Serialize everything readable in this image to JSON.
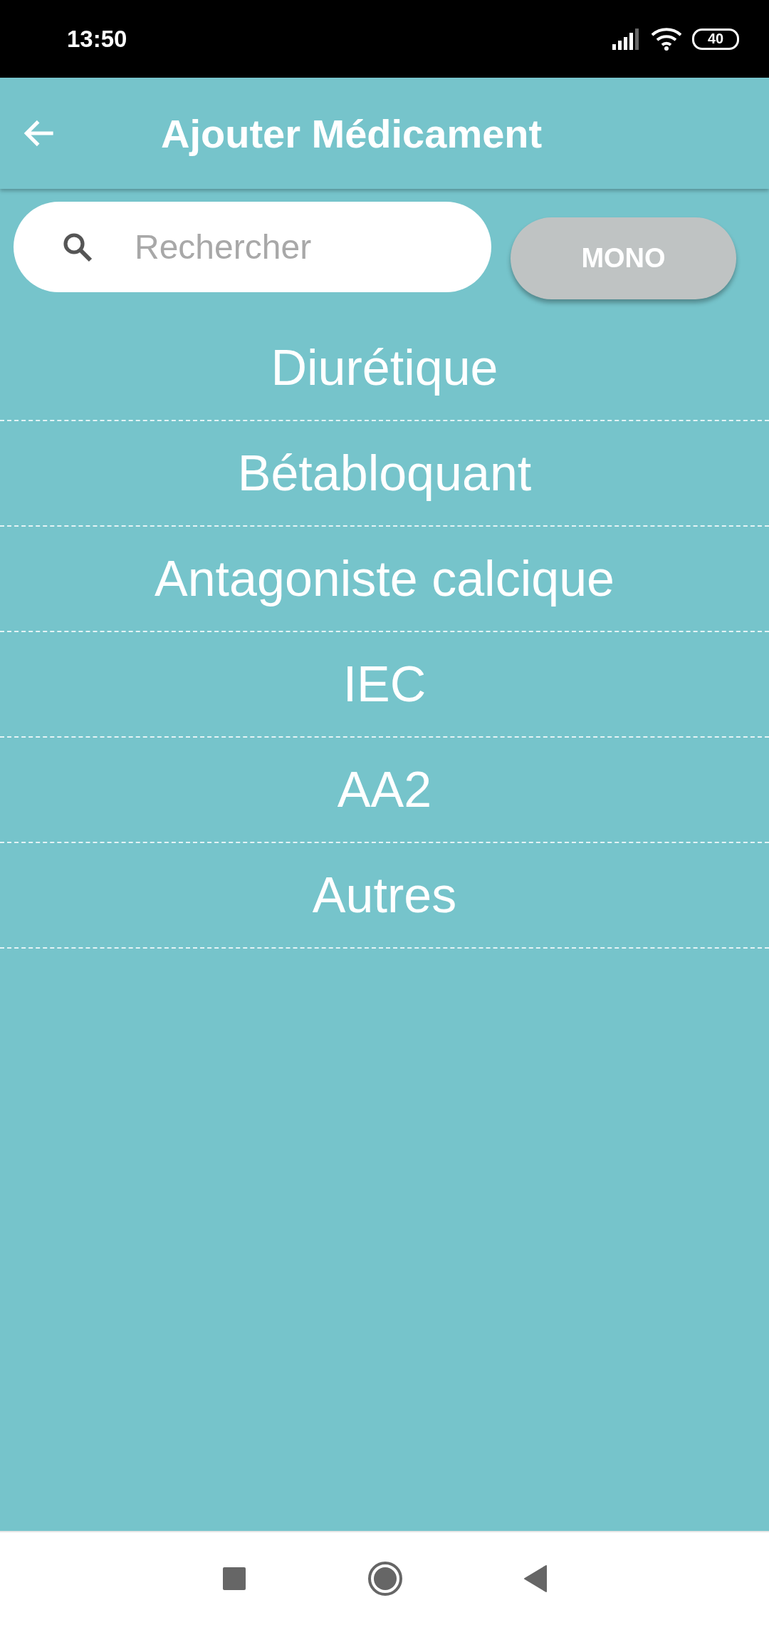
{
  "status_bar": {
    "time": "13:50",
    "battery": "40"
  },
  "header": {
    "title": "Ajouter Médicament"
  },
  "search": {
    "placeholder": "Rechercher"
  },
  "mode_button": {
    "label": "MONO"
  },
  "categories": [
    {
      "label": "Diurétique"
    },
    {
      "label": "Bétabloquant"
    },
    {
      "label": "Antagoniste calcique"
    },
    {
      "label": "IEC"
    },
    {
      "label": "AA2"
    },
    {
      "label": "Autres"
    }
  ]
}
